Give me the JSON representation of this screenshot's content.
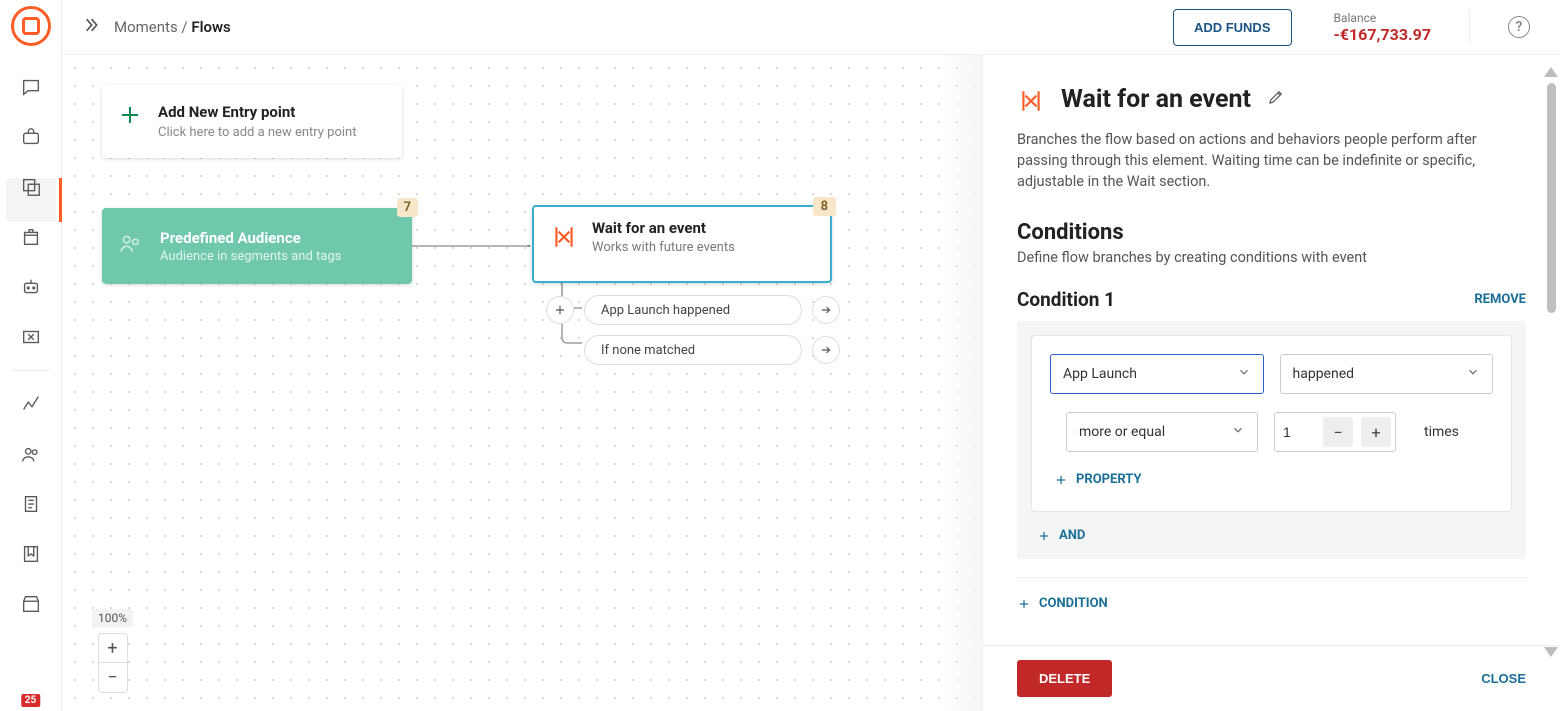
{
  "breadcrumb": {
    "parent": "Moments",
    "current": "Flows"
  },
  "topbar": {
    "add_funds": "ADD FUNDS",
    "balance_label": "Balance",
    "balance_value": "-€167,733.97"
  },
  "sidebar_badge": "25",
  "canvas": {
    "entry": {
      "title": "Add New Entry point",
      "subtitle": "Click here to add a new entry point"
    },
    "audience": {
      "title": "Predefined Audience",
      "subtitle": "Audience in segments and tags",
      "badge": "7"
    },
    "event_node": {
      "title": "Wait for an event",
      "subtitle": "Works with future events",
      "badge": "8",
      "branch1": "App Launch happened",
      "branch2": "If none matched"
    },
    "zoom": "100%"
  },
  "panel": {
    "title": "Wait for an event",
    "description": "Branches the flow based on actions and behaviors people perform after passing through this element. Waiting time can be indefinite or specific, adjustable in the Wait section.",
    "conditions_heading": "Conditions",
    "conditions_sub": "Define flow branches by creating conditions with event",
    "condition1_title": "Condition 1",
    "remove": "REMOVE",
    "event_select": "App Launch",
    "occurrence_select": "happened",
    "comparator_select": "more or equal",
    "times_value": "1",
    "times_label": "times",
    "property": "PROPERTY",
    "and": "AND",
    "condition": "CONDITION",
    "delete": "DELETE",
    "close": "CLOSE"
  }
}
